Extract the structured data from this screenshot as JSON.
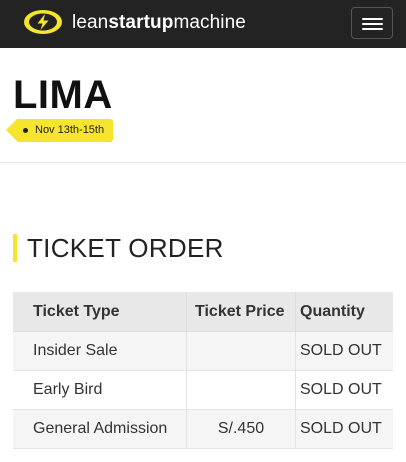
{
  "header": {
    "brand_light_1": "lean",
    "brand_bold": "startup",
    "brand_light_2": "machine",
    "logo_icon": "lightning-bolt-badge-icon",
    "menu_icon": "hamburger-menu-icon",
    "brand_color": "#f5e52c",
    "background_color": "#232323"
  },
  "event": {
    "city": "LIMA",
    "dates": "Nov 13th-15th"
  },
  "ticket_section": {
    "title": "TICKET ORDER",
    "columns": [
      "Ticket Type",
      "Ticket Price",
      "Quantity"
    ],
    "rows": [
      {
        "type": "Insider Sale",
        "price": "",
        "quantity": "SOLD OUT"
      },
      {
        "type": "Early Bird",
        "price": "",
        "quantity": "SOLD OUT"
      },
      {
        "type": "General Admission",
        "price": "S/.450",
        "quantity": "SOLD OUT"
      }
    ]
  }
}
